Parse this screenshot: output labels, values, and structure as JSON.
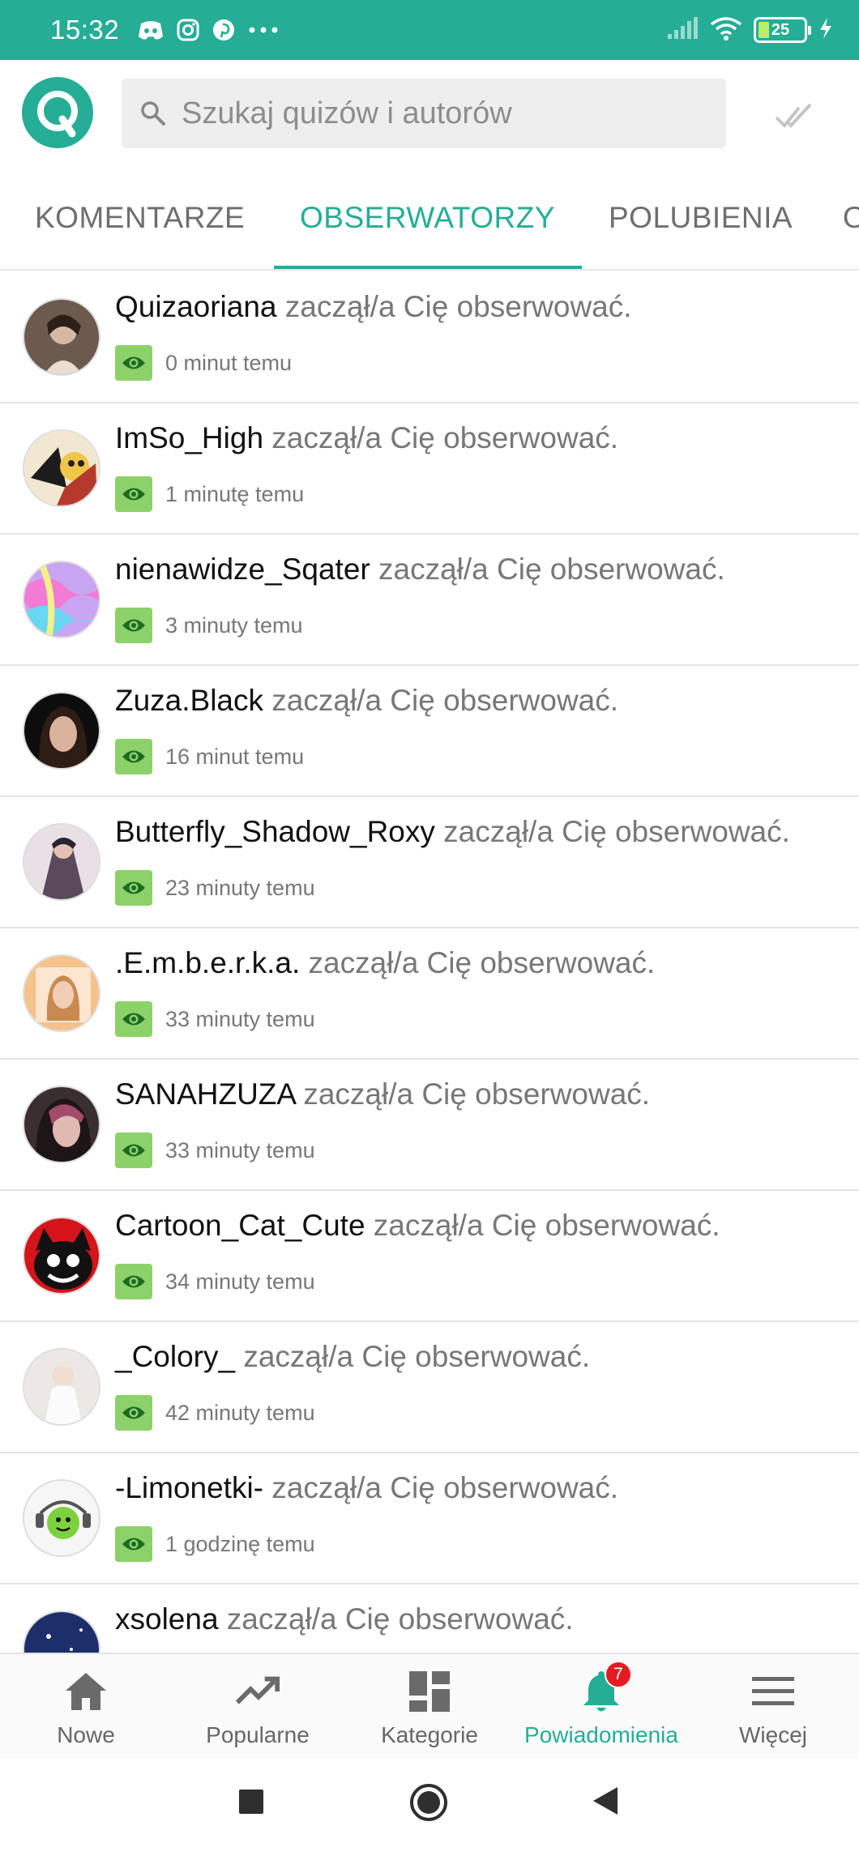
{
  "status_bar": {
    "time": "15:32",
    "battery": "25",
    "icons": [
      "discord-icon",
      "instagram-icon",
      "pinterest-icon",
      "more-dots-icon",
      "signal-icon",
      "wifi-icon",
      "battery-icon",
      "charging-icon"
    ]
  },
  "header": {
    "logo_letter": "Q",
    "search_placeholder": "Szukaj quizów i autorów"
  },
  "tabs": [
    {
      "label": "KOMENTARZE",
      "active": false
    },
    {
      "label": "OBSERWATORZY",
      "active": true
    },
    {
      "label": "POLUBIENIA",
      "active": false
    },
    {
      "label": "O",
      "active": false
    }
  ],
  "notifications": [
    {
      "username": "Quizaoriana",
      "action": " zaczął/a Cię obserwować.",
      "time": "0 minut temu"
    },
    {
      "username": "ImSo_High",
      "action": " zaczął/a Cię obserwować.",
      "time": "1 minutę temu"
    },
    {
      "username": "nienawidze_Sqater",
      "action": " zaczął/a Cię obserwować.",
      "time": "3 minuty temu"
    },
    {
      "username": "Zuza.Black",
      "action": " zaczął/a Cię obserwować.",
      "time": "16 minut temu"
    },
    {
      "username": "Butterfly_Shadow_Roxy",
      "action": " zaczął/a Cię obserwować.",
      "time": "23 minuty temu"
    },
    {
      "username": ".E.m.b.e.r.k.a.",
      "action": " zaczął/a Cię obserwować.",
      "time": "33 minuty temu"
    },
    {
      "username": "SANAHZUZA",
      "action": " zaczął/a Cię obserwować.",
      "time": "33 minuty temu"
    },
    {
      "username": "Cartoon_Cat_Cute",
      "action": " zaczął/a Cię obserwować.",
      "time": "34 minuty temu"
    },
    {
      "username": "_Colory_",
      "action": " zaczął/a Cię obserwować.",
      "time": "42 minuty temu"
    },
    {
      "username": "-Limonetki-",
      "action": " zaczął/a Cię obserwować.",
      "time": "1 godzinę temu"
    },
    {
      "username": "xsolena",
      "action": " zaczął/a Cię obserwować.",
      "time": ""
    }
  ],
  "bottom_nav": [
    {
      "label": "Nowe",
      "icon": "home-icon",
      "active": false
    },
    {
      "label": "Popularne",
      "icon": "trending-icon",
      "active": false
    },
    {
      "label": "Kategorie",
      "icon": "grid-icon",
      "active": false
    },
    {
      "label": "Powiadomienia",
      "icon": "bell-icon",
      "active": true,
      "badge": "7"
    },
    {
      "label": "Więcej",
      "icon": "menu-icon",
      "active": false
    }
  ],
  "colors": {
    "accent": "#25ad96",
    "eye_badge": "#8dd16a",
    "notification_badge": "#e51b23"
  }
}
